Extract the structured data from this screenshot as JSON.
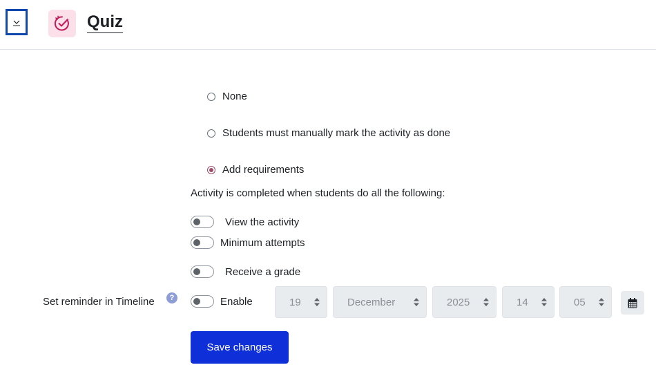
{
  "header": {
    "title": "Quiz",
    "collapse_icon": "chevron-down-icon",
    "activity_icon": "quiz-icon",
    "accent_color": "#0f47ad"
  },
  "completion_options": [
    {
      "label": "None",
      "checked": false
    },
    {
      "label": "Students must manually mark the activity as done",
      "checked": false
    },
    {
      "label": "Add requirements",
      "checked": true
    }
  ],
  "completion_text": "Activity is completed when students do all the following:",
  "requirements": [
    {
      "label": "View the activity",
      "enabled": false
    },
    {
      "label": "Minimum attempts",
      "enabled": false
    },
    {
      "label": "Receive a grade",
      "enabled": false
    }
  ],
  "reminder": {
    "label": "Set reminder in Timeline",
    "help_icon": "question-icon",
    "enable_label": "Enable",
    "enabled": false,
    "day": "19",
    "month": "December",
    "year": "2025",
    "hour": "14",
    "minute": "05",
    "calendar_icon": "calendar-icon"
  },
  "actions": {
    "save_label": "Save changes",
    "save_color": "#0f2fd8"
  }
}
